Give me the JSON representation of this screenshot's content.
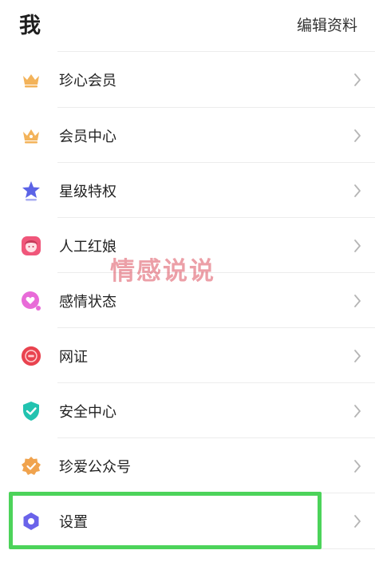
{
  "header": {
    "title": "我",
    "edit_label": "编辑资料"
  },
  "menu": {
    "items": [
      {
        "label": "珍心会员",
        "icon": "crown-icon"
      },
      {
        "label": "会员中心",
        "icon": "crown-icon"
      },
      {
        "label": "星级特权",
        "icon": "star-icon"
      },
      {
        "label": "人工红娘",
        "icon": "matchmaker-icon"
      },
      {
        "label": "感情状态",
        "icon": "heart-icon"
      },
      {
        "label": "网证",
        "icon": "id-badge-icon"
      },
      {
        "label": "安全中心",
        "icon": "shield-check-icon"
      },
      {
        "label": "珍爱公众号",
        "icon": "verified-badge-icon"
      },
      {
        "label": "设置",
        "icon": "gear-icon"
      }
    ]
  },
  "watermark": {
    "text": "情感说说"
  },
  "colors": {
    "highlight": "#4cd35a",
    "crown": "#f3b35a",
    "star": "#5b63e6",
    "matchmaker": "#f0567a",
    "heart": "#e86bd8",
    "id_badge": "#e9434f",
    "shield": "#22c3b0",
    "verified": "#f0a34e",
    "gear": "#6a63ea"
  }
}
